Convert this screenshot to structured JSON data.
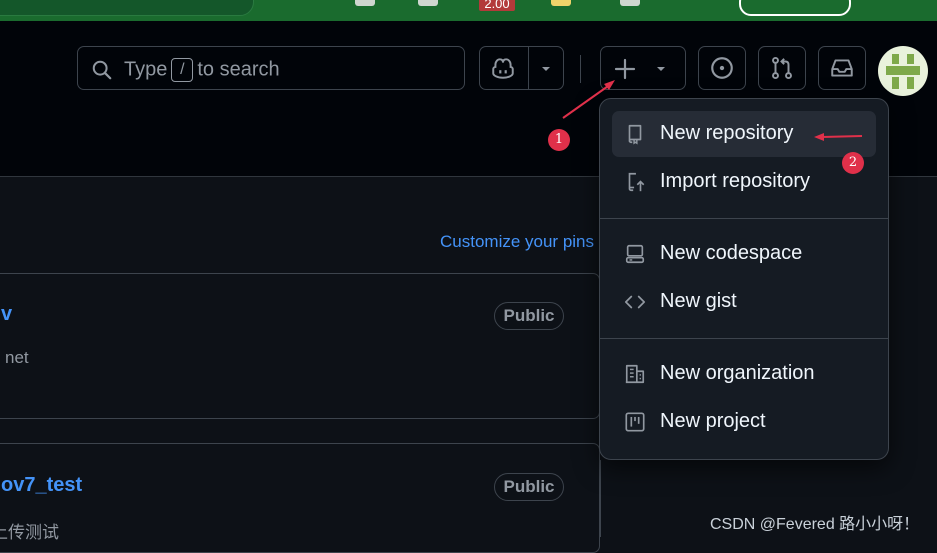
{
  "browser": {
    "badge_text": "2.00"
  },
  "header": {
    "search": {
      "prefix": "Type",
      "key": "/",
      "suffix": "to search"
    }
  },
  "dashboard": {
    "customize_pins": "Customize your pins",
    "repos": [
      {
        "name": "v",
        "description": "net",
        "visibility": "Public"
      },
      {
        "name": "ov7_test",
        "description": "上传测试",
        "visibility": "Public"
      }
    ]
  },
  "create_menu": {
    "items": [
      {
        "label": "New repository",
        "icon": "repo-icon",
        "highlighted": true
      },
      {
        "label": "Import repository",
        "icon": "repo-push-icon"
      },
      {
        "label": "New codespace",
        "icon": "codespaces-icon"
      },
      {
        "label": "New gist",
        "icon": "code-icon"
      },
      {
        "label": "New organization",
        "icon": "organization-icon"
      },
      {
        "label": "New project",
        "icon": "project-icon"
      }
    ]
  },
  "annotations": {
    "step1": "1",
    "step2": "2"
  },
  "watermark": "CSDN @Fevered 路小小呀！",
  "colors": {
    "background": "#0d1117",
    "header": "#010409",
    "menu": "#151b23",
    "link": "#4493f8",
    "annotation": "#e0304a",
    "browser_bar": "#1a6b2e"
  }
}
